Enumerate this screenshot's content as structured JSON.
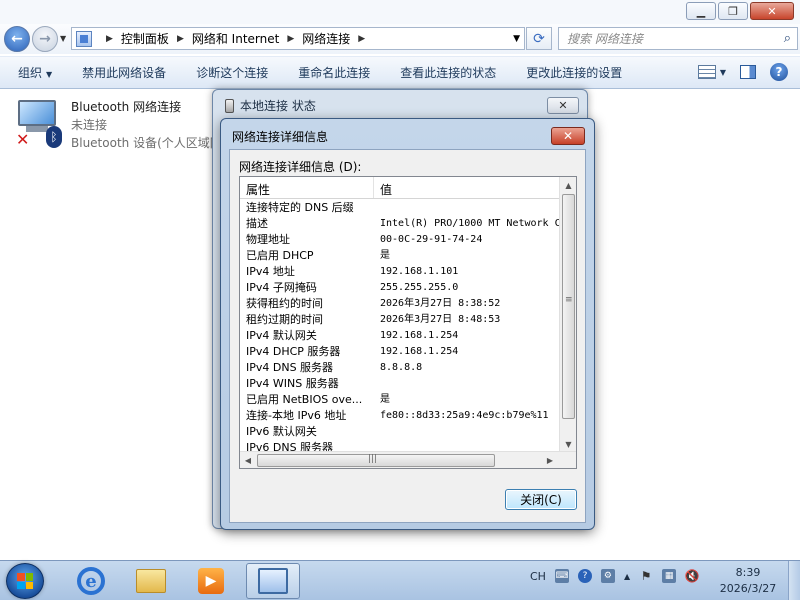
{
  "explorer": {
    "window_buttons": {
      "minimize": "▁",
      "maximize": "❐",
      "close": "✕"
    },
    "breadcrumbs": [
      "控制面板",
      "网络和 Internet",
      "网络连接"
    ],
    "search_placeholder": "搜索 网络连接",
    "toolbar": {
      "organize": "组织",
      "disable": "禁用此网络设备",
      "diagnose": "诊断这个连接",
      "rename": "重命名此连接",
      "view_status": "查看此连接的状态",
      "change_settings": "更改此连接的设置"
    },
    "connection": {
      "name": "Bluetooth 网络连接",
      "status": "未连接",
      "device": "Bluetooth 设备(个人区域网"
    }
  },
  "status_dialog": {
    "title": "本地连接 状态",
    "close": "✕"
  },
  "detail_dialog": {
    "title": "网络连接详细信息",
    "close": "✕",
    "label": "网络连接详细信息 (D):",
    "columns": [
      "属性",
      "值"
    ],
    "rows": [
      [
        "连接特定的 DNS 后缀",
        ""
      ],
      [
        "描述",
        "Intel(R) PRO/1000 MT Network C"
      ],
      [
        "物理地址",
        "00-0C-29-91-74-24"
      ],
      [
        "已启用 DHCP",
        "是"
      ],
      [
        "IPv4 地址",
        "192.168.1.101"
      ],
      [
        "IPv4 子网掩码",
        "255.255.255.0"
      ],
      [
        "获得租约的时间",
        "2026年3月27日 8:38:52"
      ],
      [
        "租约过期的时间",
        "2026年3月27日 8:48:53"
      ],
      [
        "IPv4 默认网关",
        "192.168.1.254"
      ],
      [
        "IPv4 DHCP 服务器",
        "192.168.1.254"
      ],
      [
        "IPv4 DNS 服务器",
        "8.8.8.8"
      ],
      [
        "IPv4 WINS 服务器",
        ""
      ],
      [
        "已启用 NetBIOS ove...",
        "是"
      ],
      [
        "连接-本地 IPv6 地址",
        "fe80::8d33:25a9:4e9c:b79e%11"
      ],
      [
        "IPv6 默认网关",
        ""
      ],
      [
        "IPv6 DNS 服务器",
        ""
      ]
    ],
    "close_button": "关闭(C)"
  },
  "taskbar": {
    "lang": "CH",
    "time": "8:39",
    "date": "2026/3/27"
  }
}
